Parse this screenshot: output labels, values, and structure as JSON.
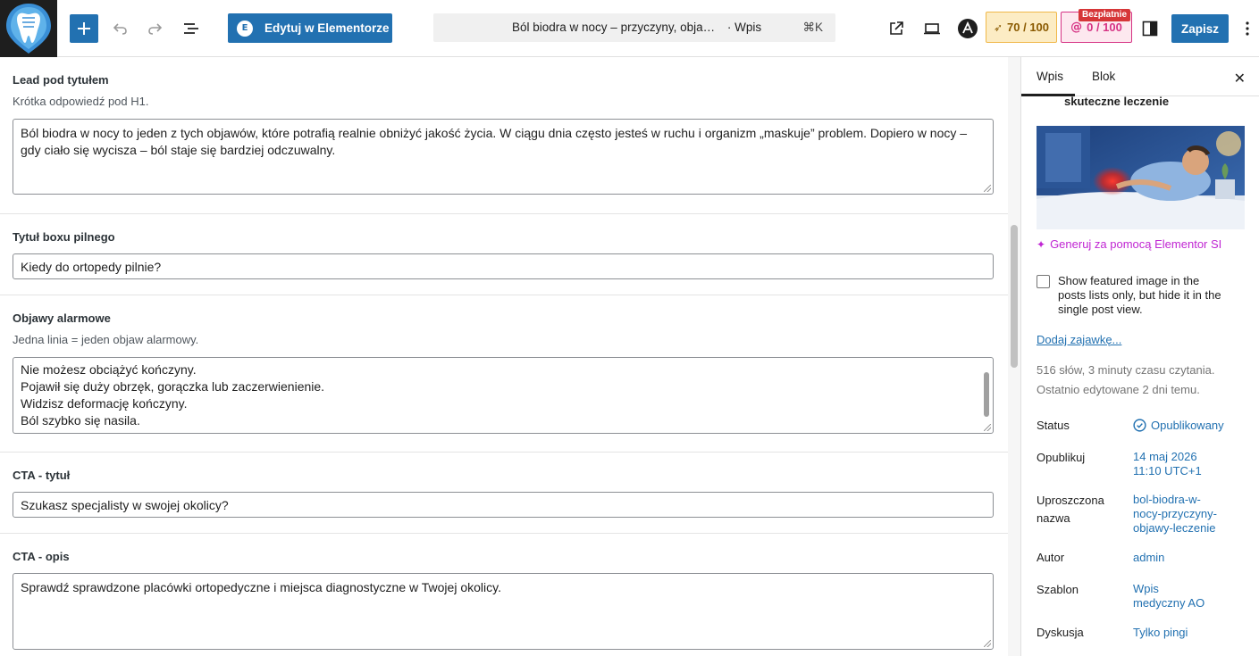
{
  "header": {
    "edit_elementor_label": "Edytuj w Elementorze",
    "command_bar_title": "Ból biodra w nocy – przyczyny, obja…",
    "command_bar_type": "· Wpis",
    "command_bar_shortcut": "⌘K",
    "ai_score": "70 / 100",
    "at_score": "0 / 100",
    "free_badge": "Bezpłatnie",
    "save_label": "Zapisz"
  },
  "fields": {
    "lead": {
      "label": "Lead pod tytułem",
      "hint": "Krótka odpowiedź pod H1.",
      "value": "Ból biodra w nocy to jeden z tych objawów, które potrafią realnie obniżyć jakość życia. W ciągu dnia często jesteś w ruchu i organizm „maskuje” problem. Dopiero w nocy – gdy ciało się wycisza – ból staje się bardziej odczuwalny."
    },
    "urgent_box": {
      "label": "Tytuł boxu pilnego",
      "value": "Kiedy do ortopedy pilnie?"
    },
    "alarm": {
      "label": "Objawy alarmowe",
      "hint": "Jedna linia = jeden objaw alarmowy.",
      "lines": [
        "Nie możesz obciążyć kończyny.",
        "Pojawił się duży obrzęk, gorączka lub zaczerwienienie.",
        "Widzisz deformację kończyny.",
        "Ból szybko się nasila."
      ]
    },
    "cta_title": {
      "label": "CTA - tytuł",
      "value": "Szukasz specjalisty w swojej okolicy?"
    },
    "cta_desc": {
      "label": "CTA - opis",
      "value": "Sprawdź sprawdzone placówki ortopedyczne i miejsca diagnostyczne w Twojej okolicy."
    }
  },
  "sidebar": {
    "tab_post": "Wpis",
    "tab_block": "Blok",
    "featured_caption": "skuteczne leczenie",
    "generate_ai": "Generuj za pomocą Elementor SI",
    "show_featured_label": "Show featured image in the posts lists only, but hide it in the single post view.",
    "add_excerpt": "Dodaj zajawkę...",
    "word_count": "516 słów, 3 minuty czasu czytania.",
    "last_edited": "Ostatnio edytowane 2 dni temu.",
    "rows": [
      {
        "label": "Status",
        "value": "Opublikowany"
      },
      {
        "label": "Opublikuj",
        "value_line1": "14 maj 2026",
        "value_line2": "11:10 UTC+1"
      },
      {
        "label_line1": "Uproszczona",
        "label_line2": "nazwa",
        "value_line1": "bol-biodra-w-",
        "value_line2": "nocy-przyczyny-",
        "value_line3": "objawy-leczenie"
      },
      {
        "label": "Autor",
        "value": "admin"
      },
      {
        "label": "Szablon",
        "value_line1": "Wpis",
        "value_line2": "medyczny AO"
      },
      {
        "label": "Dyskusja",
        "value": "Tylko pingi"
      }
    ]
  },
  "colors": {
    "accent": "#2271b1",
    "elementor_ai": "#c026d3",
    "status_blue": "#2271b1"
  }
}
